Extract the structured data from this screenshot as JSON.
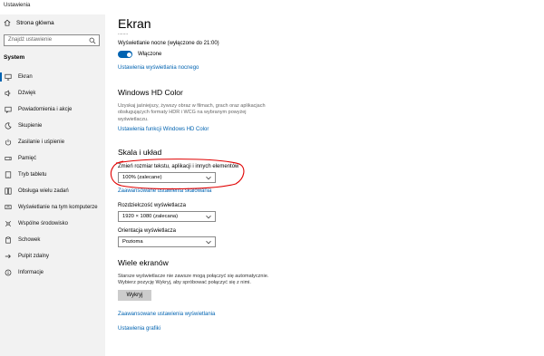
{
  "window": {
    "title": "Ustawienia"
  },
  "sidebar": {
    "home_label": "Strona główna",
    "search_placeholder": "Znajdź ustawienie",
    "section_title": "System",
    "items": [
      {
        "label": "Ekran",
        "icon": "monitor-icon",
        "active": true
      },
      {
        "label": "Dźwięk",
        "icon": "speaker-icon"
      },
      {
        "label": "Powiadomienia i akcje",
        "icon": "notification-icon"
      },
      {
        "label": "Skupienie",
        "icon": "moon-icon"
      },
      {
        "label": "Zasilanie i uśpienie",
        "icon": "power-icon"
      },
      {
        "label": "Pamięć",
        "icon": "storage-icon"
      },
      {
        "label": "Tryb tabletu",
        "icon": "tablet-icon"
      },
      {
        "label": "Obsługa wielu zadań",
        "icon": "multitask-icon"
      },
      {
        "label": "Wyświetlanie na tym komputerze",
        "icon": "project-icon"
      },
      {
        "label": "Wspólne środowisko",
        "icon": "shared-icon"
      },
      {
        "label": "Schowek",
        "icon": "clipboard-icon"
      },
      {
        "label": "Pulpit zdalny",
        "icon": "remote-icon"
      },
      {
        "label": "Informacje",
        "icon": "info-icon"
      }
    ]
  },
  "main": {
    "title": "Ekran",
    "partial_text": "........",
    "night_light": {
      "label": "Wyświetlanie nocne (wyłączone do 21:00)",
      "toggle_state": "Włączone",
      "settings_link": "Ustawienia wyświetlania nocnego"
    },
    "hdr": {
      "heading": "Windows HD Color",
      "description_lines": [
        "Uzyskaj jaśniejszy, żywszy obraz w filmach, grach oraz aplikacjach",
        "obsługujących formaty HDR i WCG na wybranym powyżej",
        "wyświetlaczu."
      ],
      "link": "Ustawienia funkcji Windows HD Color"
    },
    "scale": {
      "heading": "Skala i układ",
      "size_label": "Zmień rozmiar tekstu, aplikacji i innych elementów",
      "size_value": "100% (zalecane)",
      "advanced_link": "Zaawansowane ustawienia skalowania",
      "resolution_label": "Rozdzielczość wyświetlacza",
      "resolution_value": "1920 × 1080 (zalecana)",
      "orientation_label": "Orientacja wyświetlacza",
      "orientation_value": "Pozioma"
    },
    "multi": {
      "heading": "Wiele ekranów",
      "description_lines": [
        "Starsze wyświetlacze nie zawsze mogą połączyć się automatycznie.",
        "Wybierz pozycję Wykryj, aby spróbować połączyć się z nimi."
      ],
      "detect_button": "Wykryj",
      "advanced_display_link": "Zaawansowane ustawienia wyświetlania",
      "graphics_link": "Ustawienia grafiki"
    }
  },
  "colors": {
    "accent": "#0063b1",
    "annotation": "#e00000",
    "sidebar_bg": "#f2f2f2"
  }
}
